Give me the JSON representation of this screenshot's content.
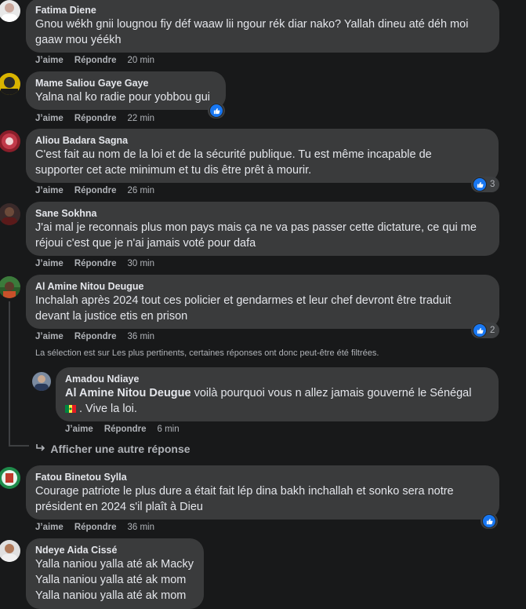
{
  "labels": {
    "like": "J’aime",
    "reply": "Répondre"
  },
  "comments": [
    {
      "author": "Fatima Diene",
      "lines": [
        "Gnou wékh gnii lougnou fiy déf waaw lii ngour rék diar nako? Yallah dineu até déh moi",
        "gaaw mou yéékh"
      ],
      "time": "20 min"
    },
    {
      "author": "Mame Saliou Gaye Gaye",
      "lines": [
        "Yalna nal ko radie pour yobbou gui"
      ],
      "time": "22 min"
    },
    {
      "author": "Aliou Badara Sagna",
      "lines": [
        "C'est fait au nom de la loi et de la sécurité publique. Tu est même incapable de",
        "supporter cet acte minimum et tu dis être prêt à mourir."
      ],
      "time": "26 min",
      "reactions": "3"
    },
    {
      "author": "Sane Sokhna",
      "lines": [
        "J'ai mal je reconnais plus mon pays mais ça ne va pas passer cette dictature, ce qui me",
        "réjoui c'est que je n'ai jamais voté pour dafa"
      ],
      "time": "30 min"
    },
    {
      "author": "Al Amine Nitou Deugue",
      "lines": [
        "Inchalah après 2024 tout ces policier et gendarmes et leur chef devront être traduit",
        "devant la justice etis en prison"
      ],
      "time": "36 min",
      "reactions": "2"
    },
    {
      "author": "Fatou Binetou Sylla",
      "lines": [
        "Courage patriote le plus dure a était fait lép dina bakh inchallah et sonko sera notre",
        "président en 2024 s'il plaît à Dieu"
      ],
      "time": "36 min"
    },
    {
      "author": "Ndeye Aida Cissé",
      "lines": [
        "Yalla naniou yalla até ak Macky",
        "Yalla naniou yalla até ak mom",
        "Yalla naniou yalla até ak mom"
      ]
    }
  ],
  "filter_notice": "La sélection est sur Les plus pertinents, certaines réponses ont donc peut-être été filtrées.",
  "reply": {
    "author": "Amadou Ndiaye",
    "mention": "Al Amine Nitou Deugue",
    "text1": " voilà pourquoi vous n allez jamais gouverné le Sénégal",
    "text2": ". Vive la loi.",
    "time": "6 min"
  },
  "more_replies": "Afficher une autre réponse",
  "colors": {
    "bubble": "#3a3b3c",
    "like_blue": "#1877f2",
    "background": "#18191a"
  }
}
